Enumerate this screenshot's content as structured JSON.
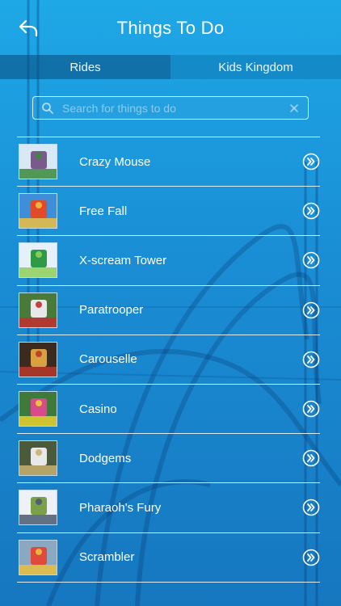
{
  "header": {
    "title": "Things To Do",
    "back_icon": "back-arrow-icon"
  },
  "tabs": [
    {
      "label": "Rides",
      "active": true
    },
    {
      "label": "Kids Kingdom",
      "active": false
    }
  ],
  "search": {
    "placeholder": "Search for things to do",
    "value": ""
  },
  "rides": [
    {
      "label": "Crazy Mouse",
      "thumb_colors": [
        "#d8e8f4",
        "#7a5a8a",
        "#3a8a3a"
      ]
    },
    {
      "label": "Free Fall",
      "thumb_colors": [
        "#3f8fd8",
        "#e24a2a",
        "#f0c040"
      ]
    },
    {
      "label": "X-scream Tower",
      "thumb_colors": [
        "#e6f0f8",
        "#2f9a45",
        "#8fcf5a"
      ]
    },
    {
      "label": "Paratrooper",
      "thumb_colors": [
        "#4a7a3a",
        "#e8e8e8",
        "#c23030"
      ]
    },
    {
      "label": "Carouselle",
      "thumb_colors": [
        "#3a2a20",
        "#d8a040",
        "#b83a2a"
      ]
    },
    {
      "label": "Casino",
      "thumb_colors": [
        "#3f7a3a",
        "#d84a8a",
        "#e8d030"
      ]
    },
    {
      "label": "Dodgems",
      "thumb_colors": [
        "#4a5a3a",
        "#e8e8e8",
        "#c8b070"
      ]
    },
    {
      "label": "Pharaoh's Fury",
      "thumb_colors": [
        "#eef2f6",
        "#7aa04a",
        "#4a5a70"
      ]
    },
    {
      "label": "Scrambler",
      "thumb_colors": [
        "#8aa8c0",
        "#e04a3a",
        "#e8c040"
      ]
    }
  ],
  "row_icon": "circle-chevron-right-icon",
  "colors": {
    "background_top": "#1ea8e6",
    "background_bottom": "#1677bf",
    "tab_active": "#084878"
  }
}
